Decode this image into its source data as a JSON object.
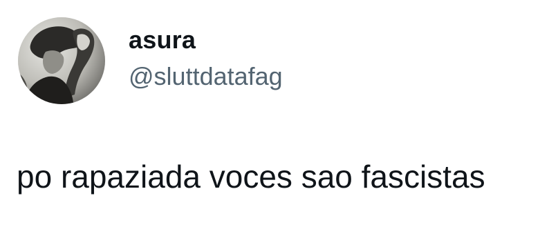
{
  "tweet": {
    "author": {
      "display_name": "asura",
      "handle": "@sluttdatafag",
      "avatar_icon": "profile-photo"
    },
    "text": "po rapaziada voces sao fascistas"
  },
  "colors": {
    "text_primary": "#0f1419",
    "text_secondary": "#536471",
    "background": "#ffffff"
  }
}
